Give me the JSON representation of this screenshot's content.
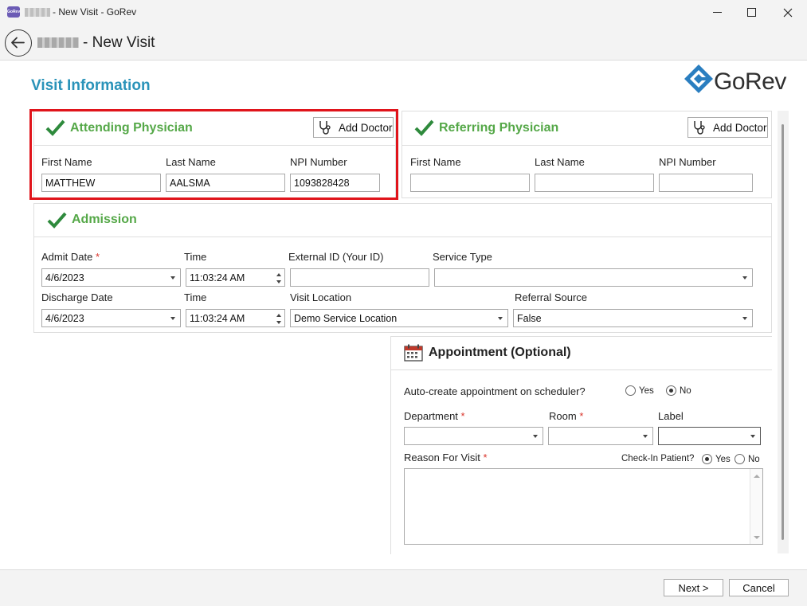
{
  "window": {
    "title": "- New Visit - GoRev",
    "app_icon_label": "GoRev",
    "controls": {
      "minimize": "minimize-icon",
      "maximize": "maximize-icon",
      "close": "close-icon"
    }
  },
  "header": {
    "title": "- New Visit",
    "back_icon": "back-arrow-icon"
  },
  "page": {
    "title": "Visit Information",
    "logo_text": "GoRev"
  },
  "attending": {
    "title": "Attending Physician",
    "add_doctor": "Add Doctor",
    "first_name_label": "First Name",
    "last_name_label": "Last Name",
    "npi_label": "NPI Number",
    "first_name": "MATTHEW",
    "last_name": "AALSMA",
    "npi": "1093828428"
  },
  "referring": {
    "title": "Referring Physician",
    "add_doctor": "Add Doctor",
    "first_name_label": "First Name",
    "last_name_label": "Last Name",
    "npi_label": "NPI Number",
    "first_name": "",
    "last_name": "",
    "npi": ""
  },
  "admission": {
    "title": "Admission",
    "admit_date_label": "Admit Date",
    "time_label": "Time",
    "external_id_label": "External ID (Your ID)",
    "service_type_label": "Service Type",
    "discharge_date_label": "Discharge Date",
    "time2_label": "Time",
    "visit_location_label": "Visit Location",
    "referral_source_label": "Referral Source",
    "required_mark": "*",
    "admit_date": "4/6/2023",
    "admit_time": "11:03:24 AM",
    "external_id": "",
    "service_type": "",
    "discharge_date": "4/6/2023",
    "discharge_time": "11:03:24 AM",
    "visit_location": "Demo Service Location",
    "referral_source": "False"
  },
  "appointment": {
    "title": "Appointment (Optional)",
    "auto_create_label": "Auto-create appointment on scheduler?",
    "yes": "Yes",
    "no": "No",
    "auto_create_value": "No",
    "department_label": "Department",
    "room_label": "Room",
    "label_label": "Label",
    "required_mark": "*",
    "reason_label": "Reason For Visit",
    "checkin_label": "Check-In Patient?",
    "checkin_value": "Yes",
    "department": "",
    "room": "",
    "label": "",
    "reason": ""
  },
  "footer": {
    "next": "Next >",
    "cancel": "Cancel"
  },
  "colors": {
    "accent_title": "#2a93b9",
    "section_green": "#55a848",
    "highlight_red": "#e0141b",
    "required_red": "#d9342b"
  }
}
